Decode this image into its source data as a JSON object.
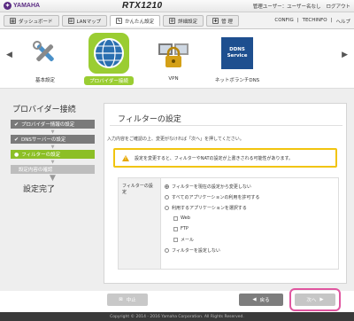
{
  "header": {
    "brand": "YAMAHA",
    "model": "RTX1210",
    "user_links": [
      "管理ユーザー：ユーザー名なし",
      "ログアウト"
    ]
  },
  "tabs": [
    {
      "label": "ダッシュボード",
      "icon": "dashboard-icon"
    },
    {
      "label": "LANマップ",
      "icon": "lan-map-icon"
    },
    {
      "label": "かんたん設定",
      "icon": "easy-setup-icon",
      "active": true
    },
    {
      "label": "詳細設定",
      "icon": "gear-icon"
    },
    {
      "label": "管 理",
      "icon": "wrench-icon"
    }
  ],
  "top_links": [
    "CONFIG",
    "TECHINFO",
    "ヘルプ"
  ],
  "carousel": {
    "items": [
      {
        "label": "基本設定",
        "icon": "tools-icon"
      },
      {
        "label": "プロバイダー接続",
        "icon": "globe-icon",
        "selected": true
      },
      {
        "label": "VPN",
        "icon": "vpn-lock-icon"
      },
      {
        "label": "ネットボランチDNS",
        "icon": "ddns-service-icon"
      }
    ],
    "ddns_icon_text": "DDNS Service"
  },
  "sidebar": {
    "title": "プロバイダー接続",
    "steps": [
      {
        "label": "プロバイダー情報の設定",
        "state": "done"
      },
      {
        "label": "DNSサーバーの設定",
        "state": "done"
      },
      {
        "label": "フィルターの設定",
        "state": "active"
      },
      {
        "label": "設定内容の確認",
        "state": "todo"
      }
    ],
    "done_label": "設定完了"
  },
  "panel": {
    "title": "フィルターの設定",
    "instruction": "入力内容をご確認の上、変更がなければ「次へ」を押してください。",
    "warning": "設定を変更すると、フィルターやNATの設定が上書きされる可能性があります。",
    "form_label": "フィルターの設定",
    "options": [
      {
        "label": "フィルターを現在の設定から変更しない",
        "type": "radio",
        "checked": true
      },
      {
        "label": "すべてのアプリケーションの利用を許可する",
        "type": "radio",
        "checked": false
      },
      {
        "label": "利用するアプリケーションを選択する",
        "type": "radio",
        "checked": false
      },
      {
        "label": "Web",
        "type": "checkbox",
        "checked": false
      },
      {
        "label": "FTP",
        "type": "checkbox",
        "checked": false
      },
      {
        "label": "メール",
        "type": "checkbox",
        "checked": false
      },
      {
        "label": "フィルターを設定しない",
        "type": "radio",
        "checked": false
      }
    ]
  },
  "buttons": {
    "cancel": "中止",
    "back": "戻る",
    "next": "次へ"
  },
  "footer": "Copyright © 2014 - 2016 Yamaha Corporation. All Rights Reserved.",
  "colors": {
    "accent_green": "#8cbf26",
    "warning_border": "#f1c40f",
    "highlight_pink": "#e056a0",
    "brand_purple": "#5b2c83"
  }
}
